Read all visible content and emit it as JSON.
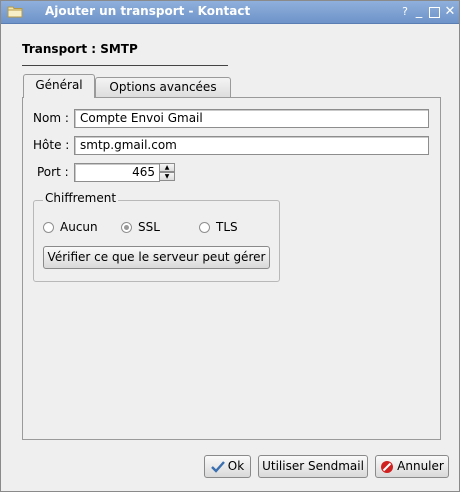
{
  "window": {
    "title": "Ajouter un transport - Kontact",
    "help_glyph": "?",
    "minimize_glyph": "_",
    "close_glyph": "✕"
  },
  "heading": "Transport : SMTP",
  "tabs": [
    {
      "label": "Général",
      "active": true
    },
    {
      "label": "Options avancées",
      "active": false
    }
  ],
  "form": {
    "name_label": "Nom :",
    "name_value": "Compte Envoi Gmail",
    "host_label": "Hôte :",
    "host_value": "smtp.gmail.com",
    "port_label": "Port :",
    "port_value": "465"
  },
  "encryption": {
    "title": "Chiffrement",
    "options": [
      {
        "label": "Aucun",
        "checked": false
      },
      {
        "label": "SSL",
        "checked": true
      },
      {
        "label": "TLS",
        "checked": false
      }
    ],
    "verify_button": "Vérifier ce que le serveur peut gérer"
  },
  "buttons": {
    "ok": "Ok",
    "sendmail": "Utiliser Sendmail",
    "cancel": "Annuler"
  },
  "colors": {
    "titlebar": "#7ea1d3",
    "ok_icon": "#3a6fb0",
    "cancel_icon": "#d02020"
  }
}
